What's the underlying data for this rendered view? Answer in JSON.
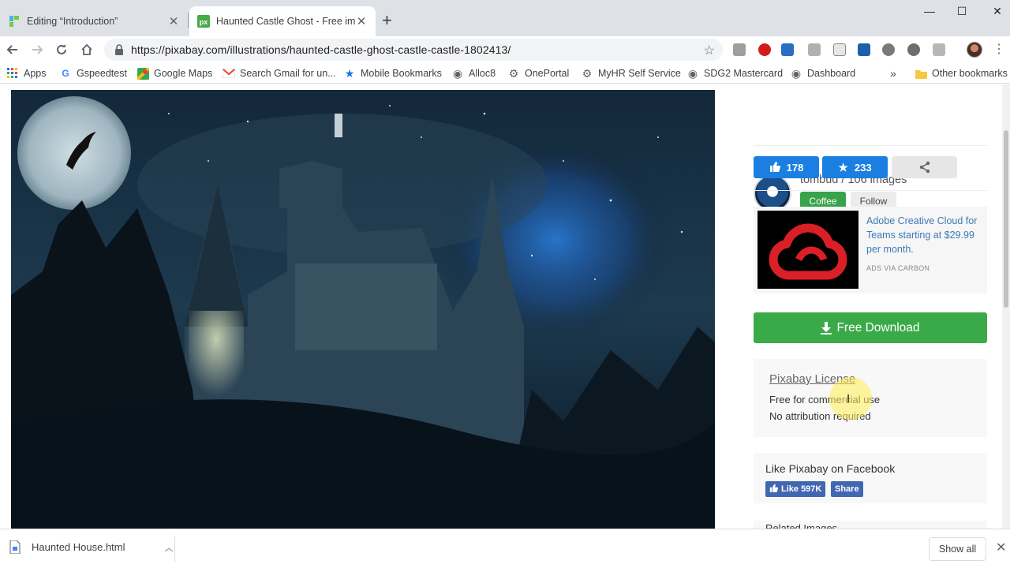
{
  "tabs": [
    {
      "title": "Editing “Introduction”",
      "favicon": "pencil-blocks-favicon",
      "active": false
    },
    {
      "title": "Haunted Castle Ghost - Free image",
      "favicon": "pixabay-favicon",
      "active": true
    }
  ],
  "window_controls": {
    "minimize": "—",
    "maximize": "☐",
    "close": "✕"
  },
  "address_bar": {
    "url": "https://pixabay.com/illustrations/haunted-castle-ghost-castle-castle-1802413/"
  },
  "bookmarks": [
    {
      "label": "Apps",
      "icon": "apps-grid-icon"
    },
    {
      "label": "Gspeedtest",
      "icon": "google-icon"
    },
    {
      "label": "Google Maps",
      "icon": "maps-icon"
    },
    {
      "label": "Search Gmail for un...",
      "icon": "gmail-icon"
    },
    {
      "label": "Mobile Bookmarks",
      "icon": "star-icon"
    },
    {
      "label": "Alloc8",
      "icon": "globe-icon"
    },
    {
      "label": "OnePortal",
      "icon": "gear-icon"
    },
    {
      "label": "MyHR Self Service",
      "icon": "gear-icon"
    },
    {
      "label": "SDG2 Mastercard",
      "icon": "globe-icon"
    },
    {
      "label": "Dashboard",
      "icon": "globe-icon"
    }
  ],
  "bookmarks_overflow": "»",
  "other_bookmarks": "Other bookmarks",
  "author": {
    "text": "tombud / 106 images",
    "coffee_label": "Coffee",
    "follow_label": "Follow"
  },
  "stats": {
    "likes": "178",
    "favorites": "233"
  },
  "ad": {
    "text": "Adobe Creative Cloud for Teams starting at $29.99 per month.",
    "via": "ADS VIA CARBON"
  },
  "download": {
    "label": "Free Download"
  },
  "license": {
    "title": "Pixabay License",
    "line1": "Free for commercial use",
    "line2": "No attribution required"
  },
  "facebook": {
    "title": "Like Pixabay on Facebook",
    "like_label": "Like 597K",
    "share_label": "Share"
  },
  "related_partial": "Related Images",
  "download_bar": {
    "file": "Haunted House.html",
    "show_all": "Show all"
  },
  "colors": {
    "green": "#3aaa48",
    "blue": "#1a7fe0",
    "adobe_red": "#da1f26",
    "facebook": "#4267b2"
  }
}
